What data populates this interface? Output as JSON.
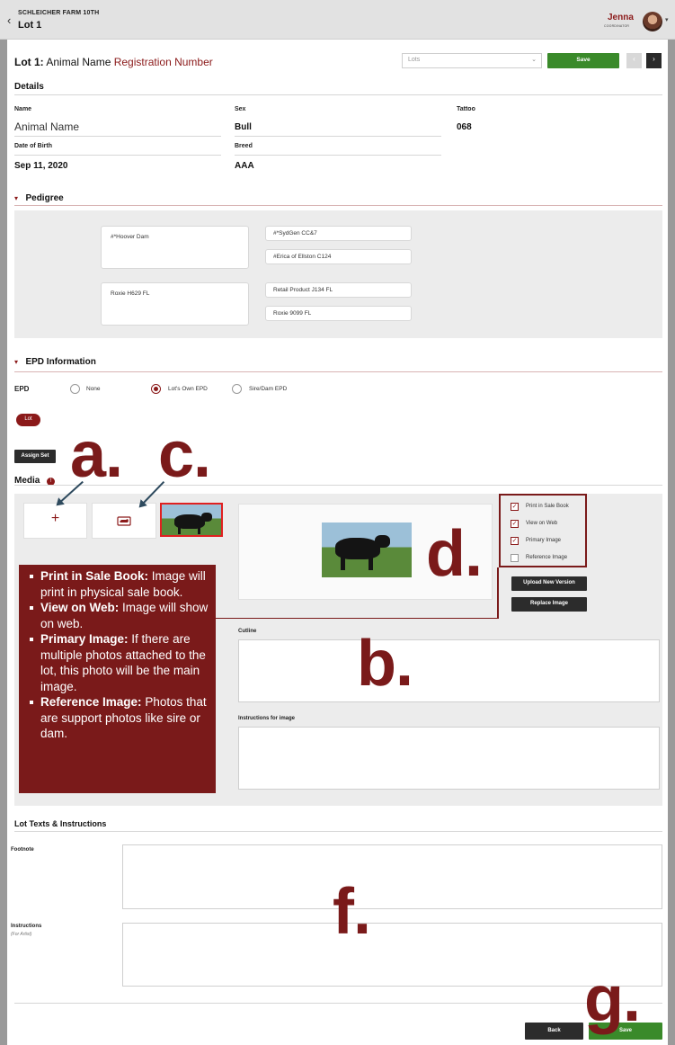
{
  "topbar": {
    "farm": "SCHLEICHER FARM 10TH",
    "lot": "Lot 1",
    "user_name": "Jenna",
    "user_role": "COORDINATOR"
  },
  "heading": {
    "lot_prefix": "Lot 1:",
    "animal_name": "Animal Name",
    "registration": "Registration Number",
    "lots_placeholder": "Lots",
    "save_label": "Save"
  },
  "details": {
    "title": "Details",
    "name_label": "Name",
    "name_value": "Animal Name",
    "sex_label": "Sex",
    "sex_value": "Bull",
    "tattoo_label": "Tattoo",
    "tattoo_value": "068",
    "dob_label": "Date of Birth",
    "dob_value": "Sep 11, 2020",
    "breed_label": "Breed",
    "breed_value": "AAA"
  },
  "pedigree": {
    "title": "Pedigree",
    "sire": "#*Hoover Dam",
    "sire_sire": "#*SydGen CC&7",
    "sire_dam": "#Erica of Ellston C124",
    "dam": "Roxie H629 FL",
    "dam_sire": "Retail Product J134 FL",
    "dam_dam": "Roxie 9099 FL"
  },
  "epd": {
    "title": "EPD Information",
    "label": "EPD",
    "options": [
      "None",
      "Lot's Own EPD",
      "Sire/Dam EPD"
    ],
    "selected": "Lot's Own EPD",
    "pill": "Lot",
    "assign_label": "Assign Set"
  },
  "media": {
    "title": "Media",
    "add_symbol": "+",
    "checkboxes": [
      {
        "label": "Print in Sale Book",
        "checked": true
      },
      {
        "label": "View on Web",
        "checked": true
      },
      {
        "label": "Primary Image",
        "checked": true
      },
      {
        "label": "Reference Image",
        "checked": false
      }
    ],
    "upload_label": "Upload New Version",
    "replace_label": "Replace Image",
    "cutline_label": "Cutline",
    "instructions_label": "Instructions for image"
  },
  "callout": {
    "items": [
      {
        "term": "Print in Sale Book:",
        "desc": " Image will print in physical sale book."
      },
      {
        "term": "View on Web:",
        "desc": " Image will show on web."
      },
      {
        "term": "Primary Image:",
        "desc": " If there are multiple photos attached to the lot, this photo will be the main image."
      },
      {
        "term": "Reference Image:",
        "desc": " Photos that are support photos like sire or dam."
      }
    ]
  },
  "annotations": {
    "a": "a.",
    "b": "b.",
    "c": "c.",
    "d": "d.",
    "f": "f.",
    "g": "g."
  },
  "lot_texts": {
    "title": "Lot Texts & Instructions",
    "footnote_label": "Footnote",
    "instructions_label": "Instructions",
    "instructions_sub": "(For Artist)"
  },
  "footer": {
    "back_label": "Back",
    "save_label": "Save"
  },
  "colors": {
    "brand": "#8b1a1a",
    "callout": "#7a1a1a",
    "save_green": "#3a8a2a"
  }
}
